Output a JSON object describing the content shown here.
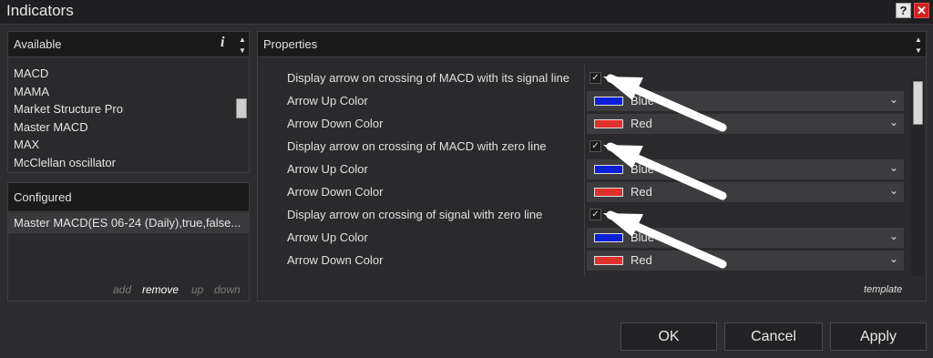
{
  "window": {
    "title": "Indicators",
    "help_glyph": "?",
    "close_glyph": "✕"
  },
  "available": {
    "header": "Available",
    "info_glyph": "i",
    "items": [
      "MACD",
      "MAMA",
      "Market Structure Pro",
      "Master MACD",
      "MAX",
      "McClellan oscillator"
    ]
  },
  "configured": {
    "header": "Configured",
    "items": [
      "Master MACD(ES 06-24 (Daily),true,false..."
    ],
    "actions": {
      "add": "add",
      "remove": "remove",
      "up": "up",
      "down": "down"
    }
  },
  "properties": {
    "header": "Properties",
    "template_link": "template",
    "rows": [
      {
        "label": "Display arrow on crossing of MACD with its signal line",
        "type": "checkbox",
        "checked": true
      },
      {
        "label": "Arrow Up Color",
        "type": "color",
        "value": "Blue",
        "swatch": "#0a1fd6"
      },
      {
        "label": "Arrow Down Color",
        "type": "color",
        "value": "Red",
        "swatch": "#e0302c"
      },
      {
        "label": "Display arrow on crossing of MACD with zero line",
        "type": "checkbox",
        "checked": true
      },
      {
        "label": "Arrow Up Color",
        "type": "color",
        "value": "Blue",
        "swatch": "#0a1fd6"
      },
      {
        "label": "Arrow Down Color",
        "type": "color",
        "value": "Red",
        "swatch": "#e0302c"
      },
      {
        "label": "Display arrow on crossing of signal with zero line",
        "type": "checkbox",
        "checked": true
      },
      {
        "label": "Arrow Up Color",
        "type": "color",
        "value": "Blue",
        "swatch": "#0a1fd6"
      },
      {
        "label": "Arrow Down Color",
        "type": "color",
        "value": "Red",
        "swatch": "#e0302c"
      }
    ]
  },
  "buttons": {
    "ok": "OK",
    "cancel": "Cancel",
    "apply": "Apply"
  },
  "glyphs": {
    "check": "✓",
    "chevron_down": "⌄",
    "up": "▲",
    "down": "▼"
  },
  "colors": {
    "accent_remove": "#ffffff",
    "action_disabled": "#7a7a7a",
    "annotation_arrow": "#ffffff"
  }
}
